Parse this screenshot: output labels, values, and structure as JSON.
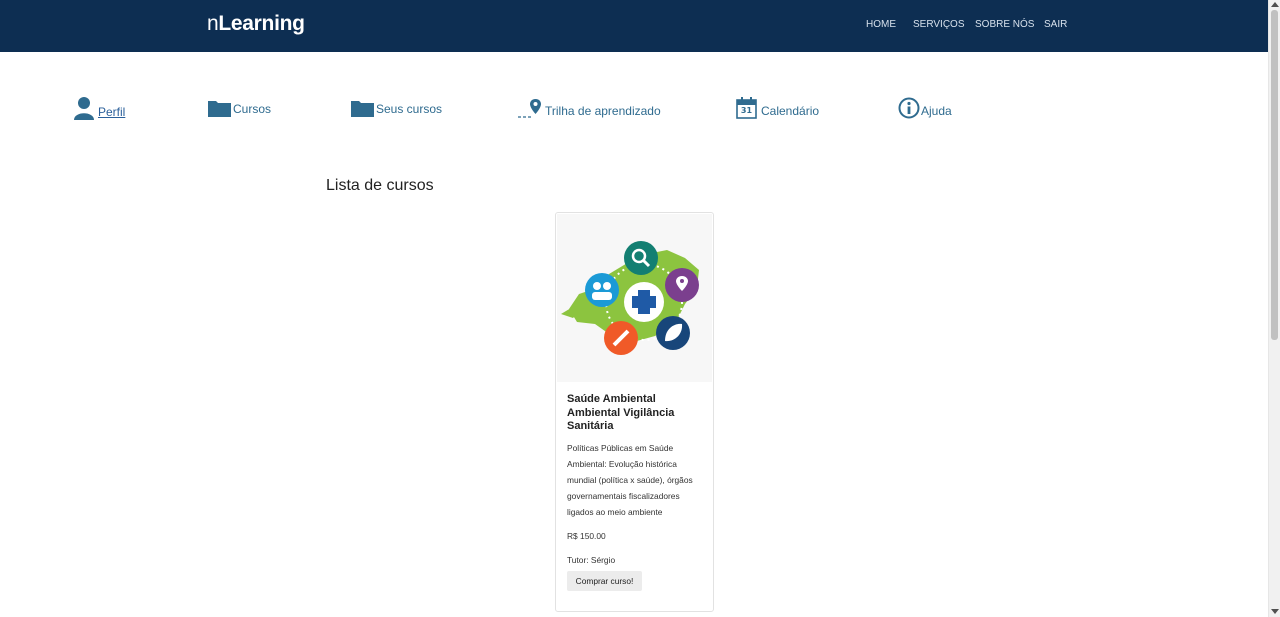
{
  "header": {
    "brand_prefix": "n",
    "brand_main": "Learning",
    "nav": [
      {
        "label": "HOME"
      },
      {
        "label": "SERVIÇOS"
      },
      {
        "label": "SOBRE NÓS"
      },
      {
        "label": "SAIR"
      }
    ],
    "background": "#0d2e52"
  },
  "menu": [
    {
      "label": "Perfil",
      "icon": "user-icon",
      "active": true
    },
    {
      "label": "Cursos",
      "icon": "folder-icon"
    },
    {
      "label": "Seus cursos",
      "icon": "folder-icon"
    },
    {
      "label": "Trilha de aprendizado",
      "icon": "map-pin-trail-icon"
    },
    {
      "label": "Calendário",
      "icon": "calendar-icon",
      "calendar_day": "31"
    },
    {
      "label": "Ajuda",
      "icon": "info-icon"
    }
  ],
  "main": {
    "title": "Lista de cursos",
    "courses": [
      {
        "title": "Saúde Ambiental Ambiental Vigilância Sanitária",
        "description": "Políticas Públicas em Saúde Ambiental: Evolução histórica mundial (política x saúde), órgãos governamentais fiscalizadores ligados ao meio ambiente",
        "price": "R$ 150.00",
        "tutor": "Tutor: Sérgio",
        "buy_label": "Comprar curso!",
        "image": "health-surveillance-map-illustration"
      }
    ]
  },
  "colors": {
    "accent": "#2f6b8f",
    "icon": "#2f6b8f"
  }
}
